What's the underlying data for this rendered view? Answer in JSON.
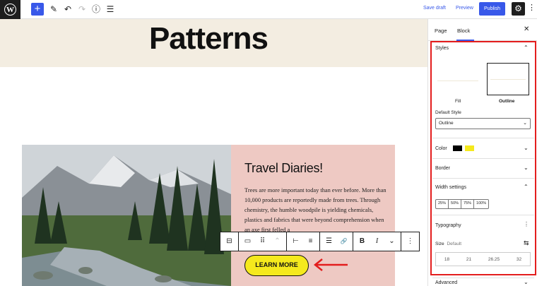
{
  "topbar": {
    "logo": "W",
    "add_icon": "+",
    "pencil_icon": "✎",
    "undo_icon": "↶",
    "redo_icon": "↷",
    "info_icon": "ⓘ",
    "list_view_icon": "☰",
    "save_draft": "Save draft",
    "preview": "Preview",
    "publish": "Publish",
    "settings_icon": "⚙",
    "more_icon": "⋮"
  },
  "canvas": {
    "heading": "Patterns",
    "hero_bg": "#f3ede1",
    "card_bg": "#eec9c3",
    "card_title": "Travel Diaries!",
    "card_text": "Trees are more important today than ever before. More than 10,000 products are reportedly made from trees. Through chemistry, the humble woodpile is yielding chemicals, plastics and fabrics that were beyond comprehension when an axe first felled a",
    "button_label": "LEARN MORE",
    "button_color": "#f5e91d"
  },
  "block_toolbar": {
    "groups": [
      [
        "⊟"
      ],
      [
        "▭",
        "⠿",
        "⌃"
      ],
      [
        "⊢",
        "≡"
      ],
      [
        "☰",
        "🔗"
      ],
      [
        "B",
        "I",
        "⌄"
      ],
      [
        "⋮"
      ]
    ]
  },
  "sidebar": {
    "tab_page": "Page",
    "tab_block": "Block",
    "close_icon": "✕",
    "styles_title": "Styles",
    "style_fill": "Fill",
    "style_outline": "Outline",
    "default_style_label": "Default Style",
    "default_style_value": "Outline",
    "color_title": "Color",
    "color_swatches": [
      "#000000",
      "#f5e91d"
    ],
    "border_title": "Border",
    "width_title": "Width settings",
    "width_options": [
      "25%",
      "50%",
      "75%",
      "100%"
    ],
    "typography_title": "Typography",
    "size_label": "Size",
    "size_default": "Default",
    "size_options": [
      "18",
      "21",
      "26.25",
      "32"
    ],
    "advanced_title": "Advanced",
    "accent": "#3858e9",
    "highlight": "#e31d1d"
  }
}
